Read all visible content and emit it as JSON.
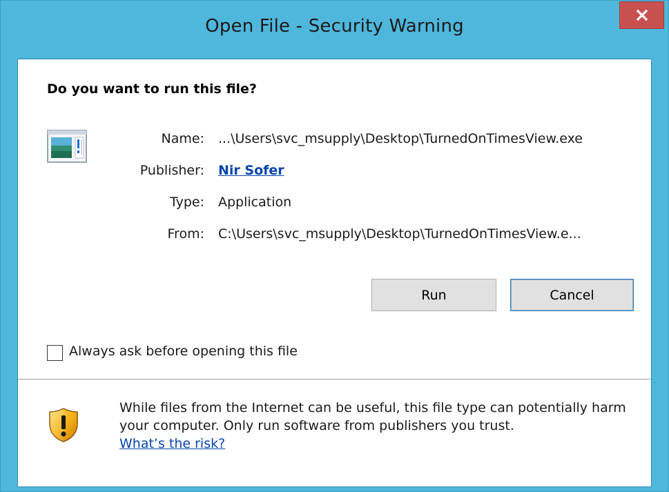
{
  "window": {
    "title": "Open File - Security Warning",
    "close_glyph": "x",
    "colors": {
      "frame": "#4fb7db",
      "close": "#c75050",
      "link": "#0645ad"
    }
  },
  "dialog": {
    "question": "Do you want to run this file?",
    "icons": {
      "file": "application-window-icon",
      "warning": "security-shield-icon"
    },
    "details": [
      {
        "label": "Name:",
        "value": "...\\Users\\svc_msupply\\Desktop\\TurnedOnTimesView.exe"
      },
      {
        "label": "Publisher:",
        "value": "Nir Sofer"
      },
      {
        "label": "Type:",
        "value": "Application"
      },
      {
        "label": "From:",
        "value": "C:\\Users\\svc_msupply\\Desktop\\TurnedOnTimesView.e..."
      }
    ],
    "buttons": {
      "run": "Run",
      "cancel": "Cancel"
    },
    "checkbox": {
      "label": "Always ask before opening this file",
      "checked": false
    },
    "warning": {
      "text": "While files from the Internet can be useful, this file type can potentially harm your computer. Only run software from publishers you trust.",
      "link": "What’s the risk?"
    }
  }
}
